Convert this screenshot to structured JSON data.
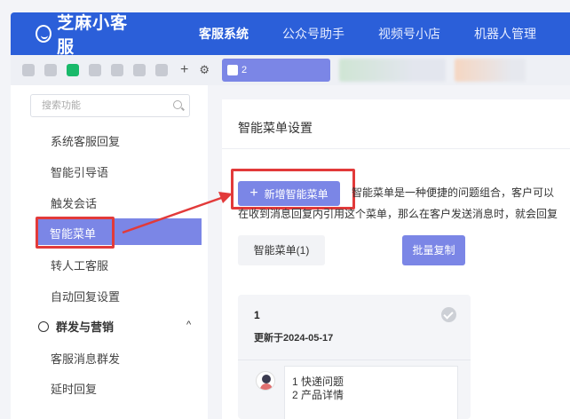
{
  "header": {
    "logo_text": "芝麻小客服",
    "nav": [
      {
        "label": "客服系统",
        "active": true
      },
      {
        "label": "公众号助手",
        "active": false
      },
      {
        "label": "视频号小店",
        "active": false
      },
      {
        "label": "机器人管理",
        "active": false
      }
    ],
    "brand_color": "#2b5fd9"
  },
  "appbar": {
    "active_tab_text": "2"
  },
  "sidebar": {
    "search_placeholder": "搜索功能",
    "items": [
      {
        "label": "系统客服回复"
      },
      {
        "label": "智能引导语"
      },
      {
        "label": "触发会话"
      },
      {
        "label": "智能菜单",
        "active": true
      },
      {
        "label": "转人工客服"
      },
      {
        "label": "自动回复设置"
      }
    ],
    "group": {
      "title": "群发与营销",
      "expanded": true
    },
    "group_items": [
      {
        "label": "客服消息群发"
      },
      {
        "label": "延时回复"
      }
    ]
  },
  "main": {
    "title": "智能菜单设置",
    "add_button": "新增智能菜单",
    "description_line1": "智能菜单是一种便捷的问题组合，客户可以",
    "description_line2": "在收到消息回复内引用这个菜单，那么在客户发送消息时，就会回复",
    "count_tab": "智能菜单(1)",
    "bulk_copy": "批量复制",
    "card": {
      "number": "1",
      "updated": "更新于2024-05-17",
      "reply_lines": [
        "1 快递问题",
        "2 产品详情"
      ]
    }
  },
  "accent_color": "#7b86e6",
  "highlight_color": "#e23a3a"
}
